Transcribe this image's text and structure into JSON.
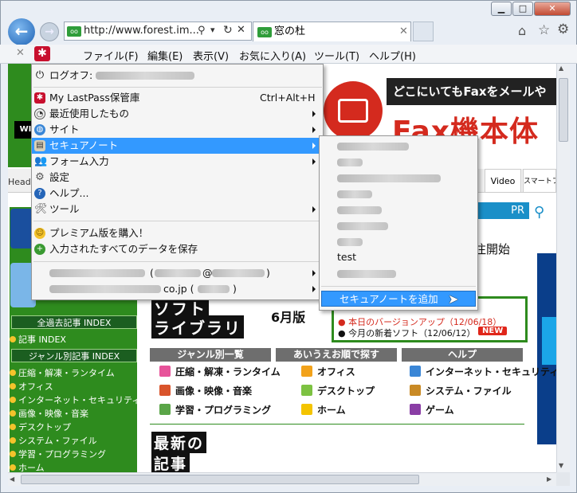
{
  "browser": {
    "address_url": "http://www.forest.im...",
    "tab_title": "窓の杜",
    "menu": [
      "ファイル(F)",
      "編集(E)",
      "表示(V)",
      "お気に入り(A)",
      "ツール(T)",
      "ヘルプ(H)"
    ]
  },
  "lastpass_menu": {
    "logoff": "ログオフ:",
    "vault": "My LastPass保管庫",
    "vault_shortcut": "Ctrl+Alt+H",
    "recent": "最近使用したもの",
    "sites": "サイト",
    "secure_notes": "セキュアノート",
    "form_fill": "フォーム入力",
    "settings": "設定",
    "help": "ヘルプ...",
    "tools": "ツール",
    "premium": "プレミアム版を購入！",
    "save_all": "入力されたすべてのデータを保存",
    "identity_at": "(",
    "identity_at_mid": "@",
    "identity_paren_close": ")",
    "identity2_domain": "co.jp (",
    "identity2_close": ")"
  },
  "secure_notes_submenu": {
    "visible_item": "test",
    "add_note": "セキュアノートを追加"
  },
  "webpage": {
    "ad_line1": "どこにいてもFaxをメールや",
    "ad_line2": "Fax機本体",
    "nav_head": "Head",
    "nav_video": "Video",
    "nav_smartphone": "スマートフォ",
    "pr": "PR",
    "search_icon": "search-icon",
    "start_text": "注開始",
    "banner_soft": "ソフト",
    "banner_library": "ライブラリ",
    "banner_month": "6月版",
    "update1": "本日のバージョンアップ（12/06/18）",
    "update2": "今月の新着ソフト（12/06/12）",
    "new_badge": "NEW",
    "sidebar": {
      "index_all": "全過去記事 INDEX",
      "article_index": "記事 INDEX",
      "office": "オフィス",
      "genre_index": "ジャンル別記事 INDEX",
      "links": [
        "圧縮・解凍・ランタイム",
        "オフィス",
        "インターネット・セキュリティ",
        "画像・映像・音楽",
        "デスクトップ",
        "システム・ファイル",
        "学習・プログラミング",
        "ホーム"
      ]
    },
    "headers": [
      "ジャンル別一覧",
      "あいうえお順で探す",
      "ヘルプ"
    ],
    "categories": [
      {
        "label": "圧縮・解凍・ランタイム",
        "color": "#e7539a"
      },
      {
        "label": "オフィス",
        "color": "#f2a21a"
      },
      {
        "label": "インターネット・セキュリティ",
        "color": "#3a86d6"
      },
      {
        "label": "画像・映像・音楽",
        "color": "#d9542b"
      },
      {
        "label": "デスクトップ",
        "color": "#7dc242"
      },
      {
        "label": "システム・ファイル",
        "color": "#c98a25"
      },
      {
        "label": "学習・プログラミング",
        "color": "#5aa548"
      },
      {
        "label": "ホーム",
        "color": "#f4c400"
      },
      {
        "label": "ゲーム",
        "color": "#8a3ea5"
      }
    ],
    "latest_title1": "最新の",
    "latest_title2": "記事"
  }
}
